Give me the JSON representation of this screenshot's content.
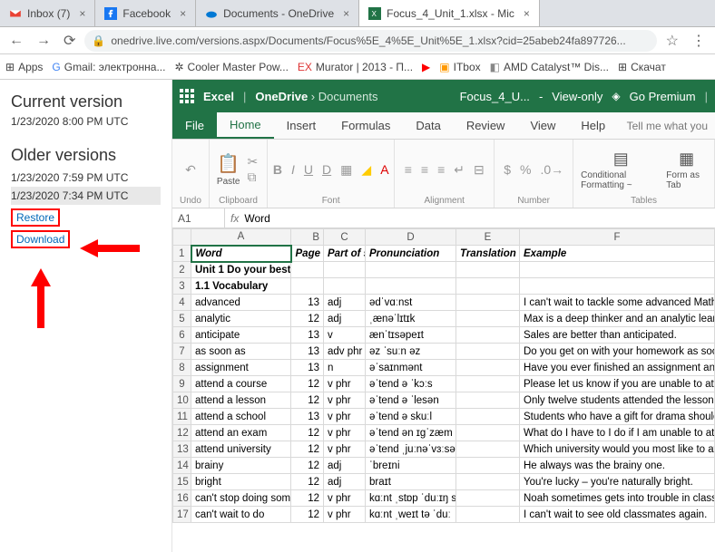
{
  "tabs": [
    {
      "icon": "gmail",
      "label": "Inbox (7)"
    },
    {
      "icon": "facebook",
      "label": "Facebook"
    },
    {
      "icon": "onedrive",
      "label": "Documents - OneDrive"
    },
    {
      "icon": "excel",
      "label": "Focus_4_Unit_1.xlsx - Mic",
      "active": true
    }
  ],
  "url": "onedrive.live.com/versions.aspx/Documents/Focus%5E_4%5E_Unit%5E_1.xlsx?cid=25abeb24fa897726...",
  "bookmarks": [
    {
      "label": "Apps",
      "icon": "apps"
    },
    {
      "label": "Gmail: электронна...",
      "icon": "google"
    },
    {
      "label": "Cooler Master Pow...",
      "icon": "cooler"
    },
    {
      "label": "Murator | 2013 - П...",
      "icon": "ex"
    },
    {
      "label": "",
      "icon": "youtube"
    },
    {
      "label": "ITbox",
      "icon": "itbox"
    },
    {
      "label": "AMD Catalyst™ Dis...",
      "icon": "amd"
    },
    {
      "label": "Скачат",
      "icon": "ms"
    }
  ],
  "versionsPanel": {
    "currentTitle": "Current version",
    "currentTime": "1/23/2020 8:00 PM UTC",
    "olderTitle": "Older versions",
    "older": [
      "1/23/2020 7:59 PM UTC",
      "1/23/2020 7:34 PM UTC"
    ],
    "restore": "Restore",
    "download": "Download"
  },
  "excelHeader": {
    "app": "Excel",
    "crumb1": "OneDrive",
    "crumb2": "Documents",
    "file": "Focus_4_U...",
    "dash": "-",
    "mode": "View-only",
    "premium": "Go Premium"
  },
  "ribbonTabs": {
    "file": "File",
    "home": "Home",
    "insert": "Insert",
    "formulas": "Formulas",
    "data": "Data",
    "review": "Review",
    "view": "View",
    "help": "Help",
    "tellme": "Tell me what you"
  },
  "ribbonGroups": {
    "undo": "Undo",
    "clipboard": "Clipboard",
    "font": "Font",
    "alignment": "Alignment",
    "number": "Number",
    "tables": "Tables",
    "paste": "Paste",
    "cond": "Conditional Formatting ~",
    "fmt": "Form as Tab"
  },
  "fx": {
    "ref": "A1",
    "val": "Word"
  },
  "columns": [
    "",
    "A",
    "B",
    "C",
    "D",
    "E",
    "F"
  ],
  "headerRow": {
    "a": "Word",
    "b": "Page",
    "c": "Part of speech",
    "d": "Pronunciation",
    "e": "Translation",
    "f": "Example"
  },
  "rows": [
    {
      "n": 2,
      "a": "Unit 1 Do your best",
      "bold": true
    },
    {
      "n": 3,
      "a": "1.1 Vocabulary",
      "bold": true
    },
    {
      "n": 4,
      "a": "advanced",
      "b": "13",
      "c": "adj",
      "d": "ədˈvɑːnst",
      "f": "I can't wait to tackle some advanced Maths."
    },
    {
      "n": 5,
      "a": "analytic",
      "b": "12",
      "c": "adj",
      "d": "ˌænəˈlɪtɪk",
      "f": "Max is a deep thinker and an analytic learner."
    },
    {
      "n": 6,
      "a": "anticipate",
      "b": "13",
      "c": "v",
      "d": "ænˈtɪsəpeɪt",
      "f": "Sales are better than anticipated."
    },
    {
      "n": 7,
      "a": "as soon as",
      "b": "13",
      "c": "adv phr",
      "d": "əz ˈsuːn əz",
      "f": "Do you get on with your homework as soon a"
    },
    {
      "n": 8,
      "a": "assignment",
      "b": "13",
      "c": "n",
      "d": "əˈsaɪnmənt",
      "f": "Have you ever finished an assignment and the"
    },
    {
      "n": 9,
      "a": "attend a course",
      "b": "12",
      "c": "v phr",
      "d": "əˈtend ə ˈkɔːs",
      "f": "Please let us know if you are unable to attend t"
    },
    {
      "n": 10,
      "a": "attend a lesson",
      "b": "12",
      "c": "v phr",
      "d": "əˈtend ə ˈlesən",
      "f": "Only twelve students attended the lesson."
    },
    {
      "n": 11,
      "a": "attend a school",
      "b": "13",
      "c": "v phr",
      "d": "əˈtend ə skuːl",
      "f": "Students who have a gift for drama should atte"
    },
    {
      "n": 12,
      "a": "attend an exam",
      "b": "12",
      "c": "v phr",
      "d": "əˈtend ən ɪɡˈzæm",
      "f": "What do I have to I do if I am unable to attend"
    },
    {
      "n": 13,
      "a": "attend university",
      "b": "12",
      "c": "v phr",
      "d": "əˈtend ˌjuːnəˈvɜːsəti",
      "f": "Which university would you most like to atten"
    },
    {
      "n": 14,
      "a": "brainy",
      "b": "12",
      "c": "adj",
      "d": "ˈbreɪni",
      "f": "He always was the brainy one."
    },
    {
      "n": 15,
      "a": "bright",
      "b": "12",
      "c": "adj",
      "d": "braɪt",
      "f": "You're lucky – you're naturally bright."
    },
    {
      "n": 16,
      "a": "can't stop doing something",
      "b": "12",
      "c": "v phr",
      "d": "kɑːnt ˌstɒp ˈduːɪŋ sʌmθɪŋ",
      "f": "Noah sometimes gets into trouble in class beca"
    },
    {
      "n": 17,
      "a": "can't wait to do",
      "b": "12",
      "c": "v phr",
      "d": "kɑːnt ˌweɪt tə ˈduː",
      "f": "I can't wait to see old classmates again."
    }
  ]
}
